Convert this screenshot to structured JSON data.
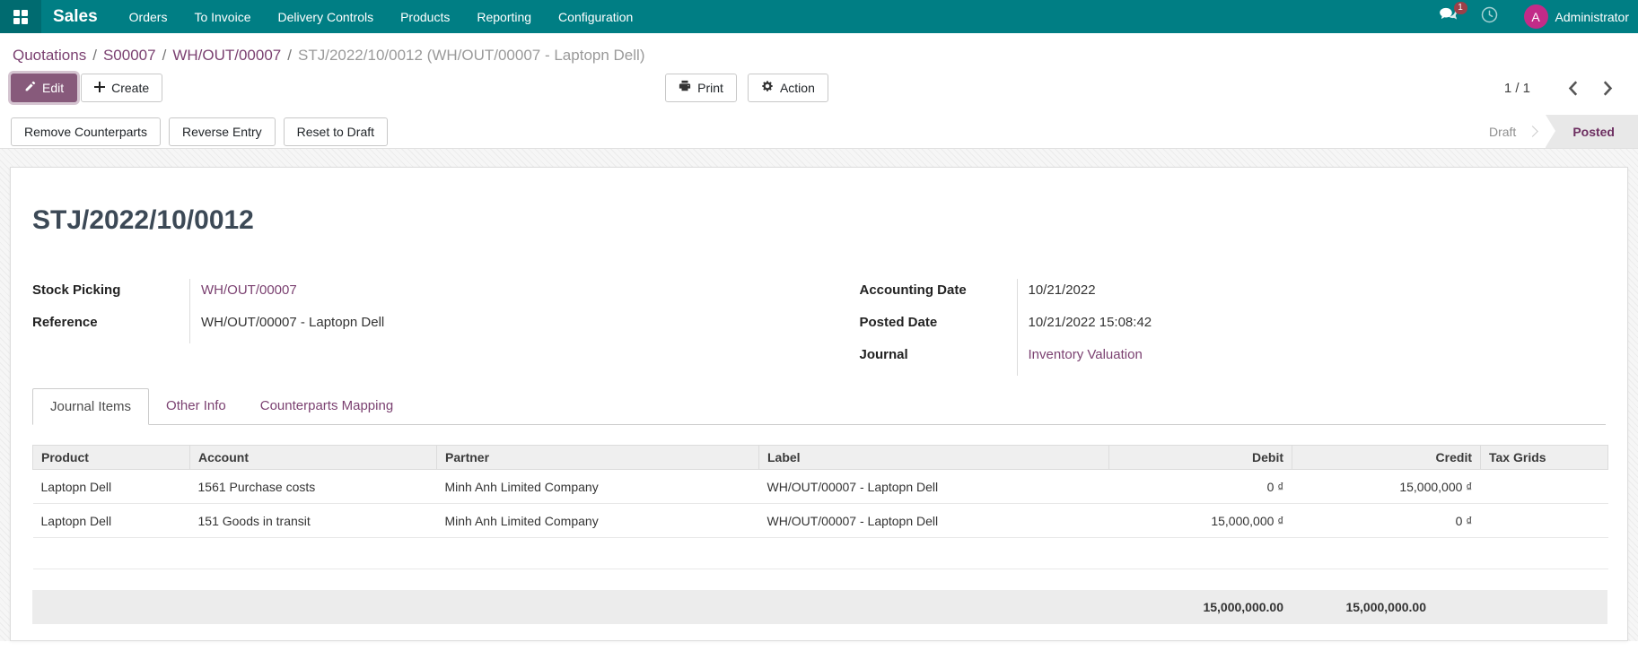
{
  "navbar": {
    "brand": "Sales",
    "menus": [
      "Orders",
      "To Invoice",
      "Delivery Controls",
      "Products",
      "Reporting",
      "Configuration"
    ],
    "message_badge": "1",
    "user": {
      "initial": "A",
      "name": "Administrator"
    },
    "colors": {
      "bg": "#007E84",
      "apps_bg": "#006B70",
      "avatar": "#C22B88",
      "badge": "#9B4049"
    }
  },
  "icons": {
    "apps": "grid-2x2",
    "messages": "chat-bubbles",
    "activities": "clock",
    "edit": "pencil",
    "create": "plus",
    "print": "printer",
    "action": "gear",
    "pager_prev": "chevron-left",
    "pager_next": "chevron-right"
  },
  "breadcrumb": {
    "separator": "/",
    "links": [
      "Quotations",
      "S00007",
      "WH/OUT/00007"
    ],
    "current": "STJ/2022/10/0012 (WH/OUT/00007 - Laptopn Dell)"
  },
  "actions": {
    "edit": "Edit",
    "create": "Create",
    "print": "Print",
    "action": "Action",
    "pager": "1 / 1"
  },
  "workflow": {
    "buttons": [
      "Remove Counterparts",
      "Reverse Entry",
      "Reset to Draft"
    ],
    "status": {
      "draft": "Draft",
      "posted": "Posted"
    }
  },
  "sheet": {
    "title": "STJ/2022/10/0012",
    "fields_left": [
      {
        "label": "Stock Picking",
        "value": "WH/OUT/00007"
      },
      {
        "label": "Reference",
        "value": "WH/OUT/00007 - Laptopn Dell"
      }
    ],
    "fields_right": [
      {
        "label": "Accounting Date",
        "value": "10/21/2022"
      },
      {
        "label": "Posted Date",
        "value": "10/21/2022 15:08:42"
      },
      {
        "label": "Journal",
        "value": "Inventory Valuation"
      }
    ],
    "tabs": [
      {
        "label": "Journal Items"
      },
      {
        "label": "Other Info"
      },
      {
        "label": "Counterparts Mapping"
      }
    ],
    "table": {
      "headers": [
        "Product",
        "Account",
        "Partner",
        "Label",
        "Debit",
        "Credit",
        "Tax Grids"
      ],
      "rows": [
        {
          "product": "Laptopn Dell",
          "account": "1561 Purchase costs",
          "partner": "Minh Anh Limited Company",
          "label": "WH/OUT/00007 - Laptopn Dell",
          "debit": "0 ₫",
          "credit": "15,000,000 ₫",
          "tax_grids": ""
        },
        {
          "product": "Laptopn Dell",
          "account": "151 Goods in transit",
          "partner": "Minh Anh Limited Company",
          "label": "WH/OUT/00007 - Laptopn Dell",
          "debit": "15,000,000 ₫",
          "credit": "0 ₫",
          "tax_grids": ""
        }
      ],
      "totals": {
        "debit": "15,000,000.00",
        "credit": "15,000,000.00"
      }
    }
  }
}
